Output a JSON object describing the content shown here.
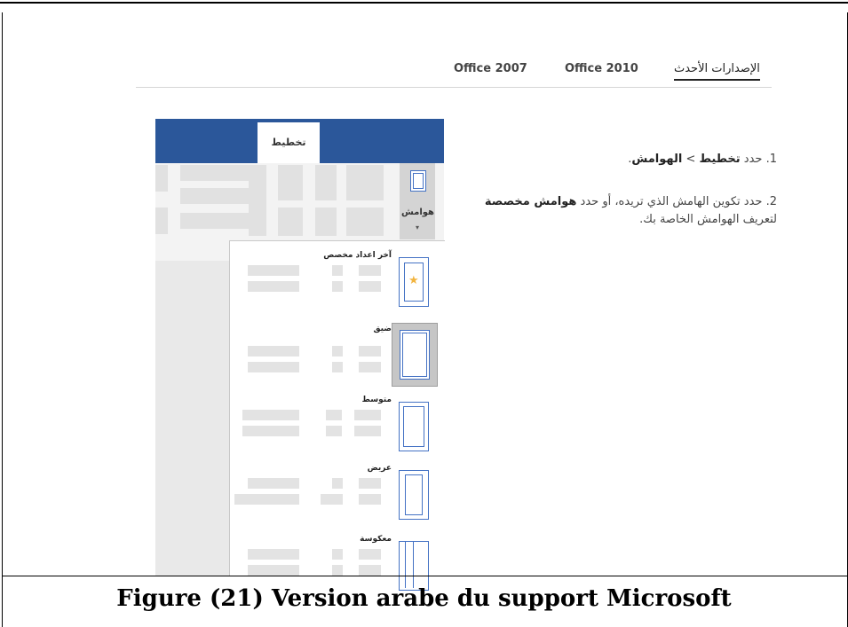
{
  "tabs": {
    "latest": "الإصدارات الأحدث",
    "office2010": "Office 2010",
    "office2007": "Office 2007"
  },
  "steps": [
    {
      "num": "1.",
      "pre": "حدد",
      "bold1": "تخطيط",
      "mid": " > ",
      "bold2": "الهوامش",
      "post": "."
    },
    {
      "num": "2.",
      "pre": "حدد تكوين الهامش الذي تريده، أو حدد",
      "bold1": "هوامش مخصصة",
      "post": "لتعريف الهوامش الخاصة بك."
    }
  ],
  "ribbon": {
    "layout_tab": "تخطيط",
    "margins_label": "هوامش",
    "accent": "#2b579a"
  },
  "margin_options": [
    {
      "name": "آخر اعداد مخصص",
      "icon": "custom-margins-icon"
    },
    {
      "name": "ضيق",
      "icon": "narrow-margins-icon"
    },
    {
      "name": "متوسط",
      "icon": "moderate-margins-icon"
    },
    {
      "name": "عريض",
      "icon": "wide-margins-icon"
    },
    {
      "name": "معكوسة",
      "icon": "mirrored-margins-icon"
    }
  ],
  "caption": "Figure (21) Version arabe du support Microsoft"
}
